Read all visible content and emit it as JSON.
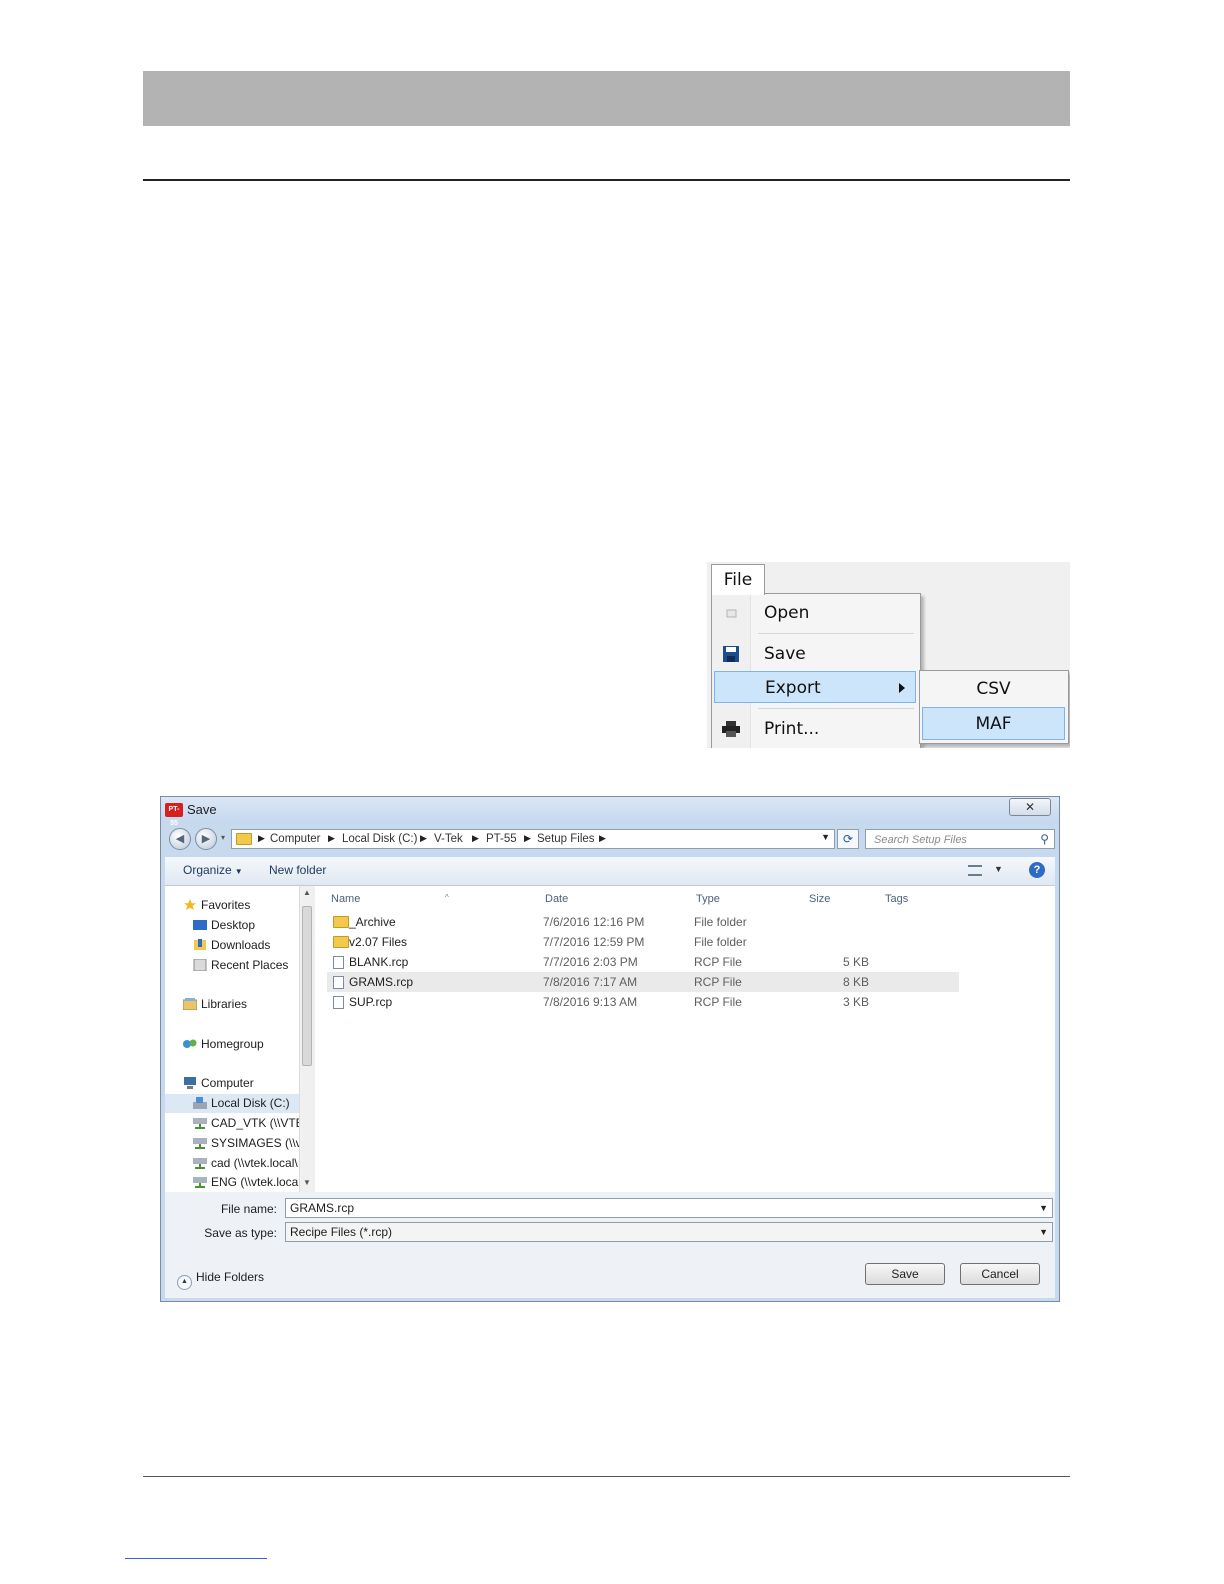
{
  "file_menu": {
    "tab_label": "File",
    "items": [
      {
        "label": "Open",
        "icon": "open-icon"
      },
      {
        "label": "Save",
        "icon": "floppy-disk-icon"
      },
      {
        "label": "Export",
        "icon": "",
        "has_submenu": true
      },
      {
        "label": "Print...",
        "icon": "printer-icon"
      }
    ],
    "export_submenu": [
      {
        "label": "CSV"
      },
      {
        "label": "MAF"
      }
    ]
  },
  "dialog": {
    "app_icon_text": "PT-55",
    "title": "Save",
    "close_symbol": "✕",
    "breadcrumb": [
      "Computer",
      "Local Disk (C:)",
      "V-Tek",
      "PT-55",
      "Setup Files"
    ],
    "search_placeholder": "Search Setup Files",
    "toolbar": {
      "organize_label": "Organize",
      "new_folder_label": "New folder"
    },
    "nav_pane": [
      {
        "label": "Favorites",
        "icon": "star-icon",
        "indent": 0
      },
      {
        "label": "Desktop",
        "icon": "desktop-icon",
        "indent": 1
      },
      {
        "label": "Downloads",
        "icon": "downloads-icon",
        "indent": 1
      },
      {
        "label": "Recent Places",
        "icon": "recent-places-icon",
        "indent": 1
      },
      {
        "label": "Libraries",
        "icon": "libraries-icon",
        "indent": 0
      },
      {
        "label": "Homegroup",
        "icon": "homegroup-icon",
        "indent": 0
      },
      {
        "label": "Computer",
        "icon": "computer-icon",
        "indent": 0
      },
      {
        "label": "Local Disk (C:)",
        "icon": "local-disk-icon",
        "indent": 1,
        "selected": true
      },
      {
        "label": "CAD_VTK (\\\\VTEI",
        "icon": "network-drive-icon",
        "indent": 1
      },
      {
        "label": "SYSIMAGES (\\\\vt",
        "icon": "network-drive-icon",
        "indent": 1
      },
      {
        "label": "cad (\\\\vtek.local\\",
        "icon": "network-drive-icon",
        "indent": 1
      },
      {
        "label": "ENG (\\\\vtek.local",
        "icon": "network-drive-icon",
        "indent": 1
      }
    ],
    "columns": {
      "name": "Name",
      "date": "Date",
      "type": "Type",
      "size": "Size",
      "tags": "Tags"
    },
    "files": [
      {
        "name": "_Archive",
        "date": "7/6/2016 12:16 PM",
        "type": "File folder",
        "size": "",
        "kind": "folder"
      },
      {
        "name": "v2.07 Files",
        "date": "7/7/2016 12:59 PM",
        "type": "File folder",
        "size": "",
        "kind": "folder"
      },
      {
        "name": "BLANK.rcp",
        "date": "7/7/2016 2:03 PM",
        "type": "RCP File",
        "size": "5 KB",
        "kind": "file"
      },
      {
        "name": "GRAMS.rcp",
        "date": "7/8/2016 7:17 AM",
        "type": "RCP File",
        "size": "8 KB",
        "kind": "file",
        "selected": true
      },
      {
        "name": "SUP.rcp",
        "date": "7/8/2016 9:13 AM",
        "type": "RCP File",
        "size": "3 KB",
        "kind": "file"
      }
    ],
    "file_name_label": "File name:",
    "file_name_value": "GRAMS.rcp",
    "save_as_type_label": "Save as type:",
    "save_as_type_value": "Recipe Files (*.rcp)",
    "hide_folders_label": "Hide Folders",
    "save_button": "Save",
    "cancel_button": "Cancel"
  }
}
